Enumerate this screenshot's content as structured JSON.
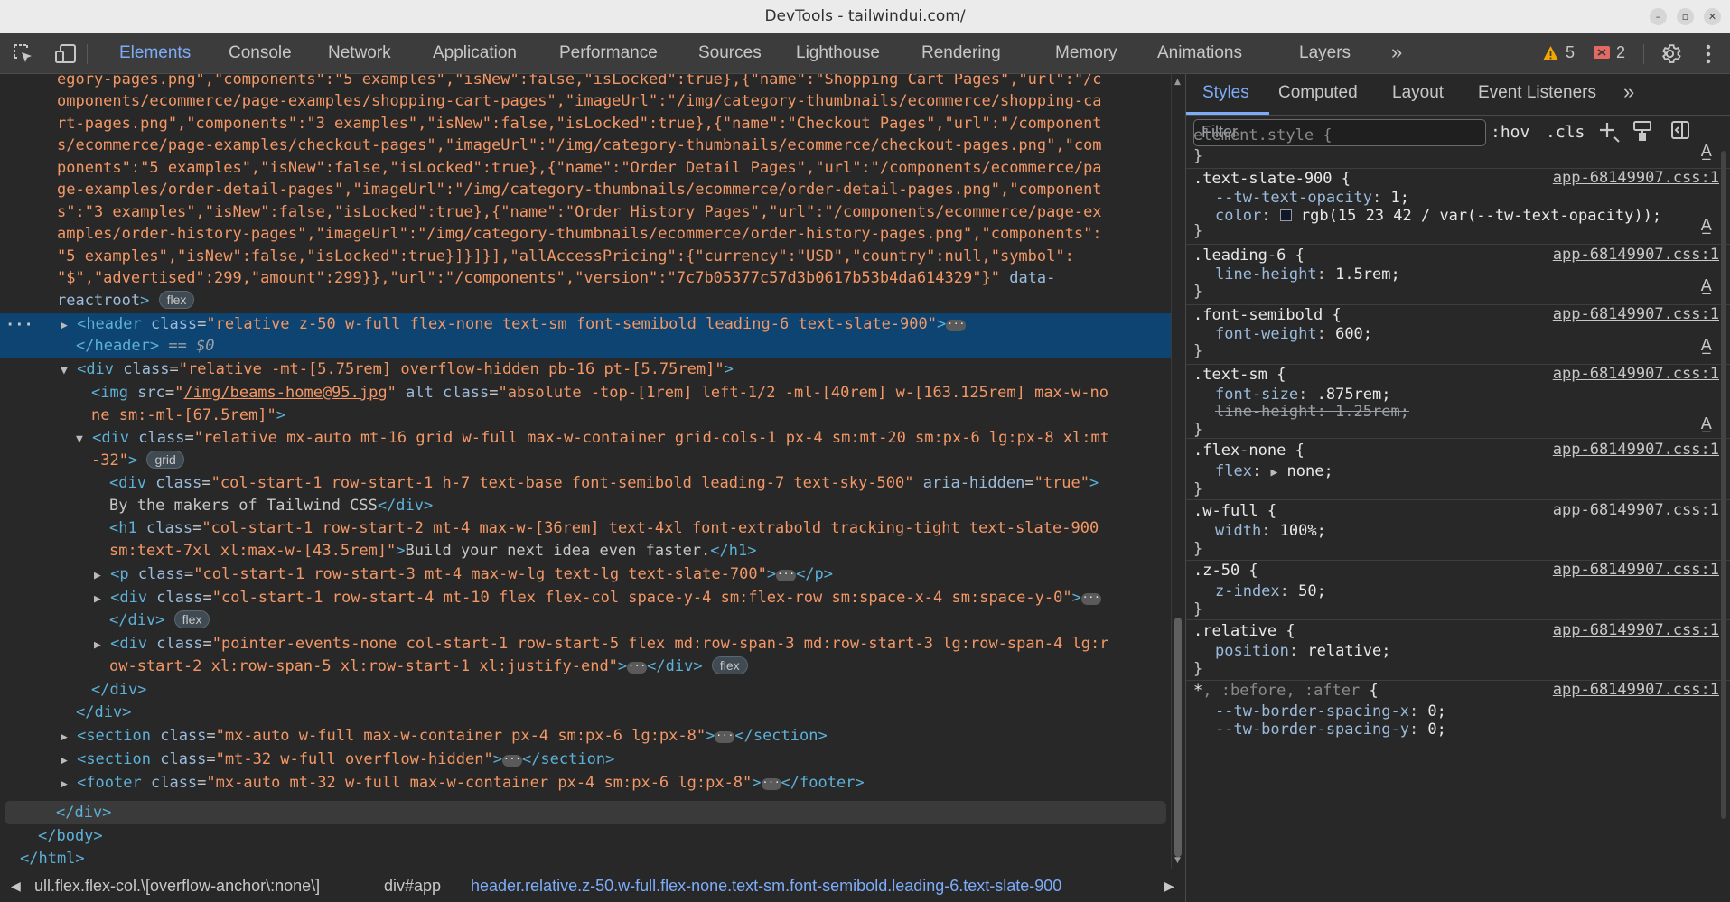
{
  "window": {
    "title": "DevTools - tailwindui.com/"
  },
  "toolbar": {
    "tabs": [
      "Elements",
      "Console",
      "Network",
      "Application",
      "Performance",
      "Sources",
      "Lighthouse",
      "Rendering",
      "Memory",
      "Animations",
      "Layers"
    ],
    "more": "»",
    "warnings": "5",
    "errors": "2"
  },
  "code": {
    "l1": "egory-pages.png\",\"components\":\"5 examples\",\"isNew\":false,\"isLocked\":true},{\"name\":\"Shopping Cart Pages\",\"url\":\"/c",
    "l2": "omponents/ecommerce/page-examples/shopping-cart-pages\",\"imageUrl\":\"/img/category-thumbnails/ecommerce/shopping-ca",
    "l3": "rt-pages.png\",\"components\":\"3 examples\",\"isNew\":false,\"isLocked\":true},{\"name\":\"Checkout Pages\",\"url\":\"/component",
    "l4": "s/ecommerce/page-examples/checkout-pages\",\"imageUrl\":\"/img/category-thumbnails/ecommerce/checkout-pages.png\",\"com",
    "l5": "ponents\":\"5 examples\",\"isNew\":false,\"isLocked\":true},{\"name\":\"Order Detail Pages\",\"url\":\"/components/ecommerce/pa",
    "l6": "ge-examples/order-detail-pages\",\"imageUrl\":\"/img/category-thumbnails/ecommerce/order-detail-pages.png\",\"component",
    "l7": "s\":\"3 examples\",\"isNew\":false,\"isLocked\":true},{\"name\":\"Order History Pages\",\"url\":\"/components/ecommerce/page-ex",
    "l8": "amples/order-history-pages\",\"imageUrl\":\"/img/category-thumbnails/ecommerce/order-history-pages.png\",\"components\":",
    "l9": "\"5 examples\",\"isNew\":false,\"isLocked\":true}]}]}],\"allAccessPricing\":{\"currency\":\"USD\",\"country\":null,\"symbol\":",
    "l10a": "\"$\",\"advertised\":299,\"amount\":299}},\"url\":\"/components\",\"version\":\"7c7b05377c57d3b0617b53b4da614329\"}\"",
    "l10b": " data-",
    "l11": "reactroot>",
    "pill_flex": "flex",
    "pill_grid": "grid",
    "header_class": "\"relative z-50 w-full flex-none text-sm font-semibold leading-6 text-slate-900\"",
    "header_close": "</header>",
    "eq": " == $0",
    "div1_class": "\"relative -mt-[5.75rem] overflow-hidden pb-16 pt-[5.75rem]\"",
    "img_src": "/img/beams-home@95.jpg",
    "img_class_a": "\"absolute -top-[1rem] left-1/2 -ml-[40rem] w-[163.125rem] max-w-no",
    "img_class_b": "ne sm:-ml-[67.5rem]\"",
    "div2_class_a": "\"relative mx-auto mt-16 grid w-full max-w-container grid-cols-1 px-4 sm:mt-20 sm:px-6 lg:px-8 xl:mt",
    "div2_class_b": "-32\"",
    "div3_class": "\"col-start-1 row-start-1 h-7 text-base font-semibold leading-7 text-sky-500\"",
    "div3_aria": "\"true\"",
    "div3_text": "By the makers of Tailwind CSS",
    "h1_class_a": "\"col-start-1 row-start-2 mt-4 max-w-[36rem] text-4xl font-extrabold tracking-tight text-slate-900",
    "h1_class_b": "sm:text-7xl xl:max-w-[43.5rem]\"",
    "h1_text": "Build your next idea even faster.",
    "p_class": "\"col-start-1 row-start-3 mt-4 max-w-lg text-lg text-slate-700\"",
    "div4_class": "\"col-start-1 row-start-4 mt-10 flex flex-col space-y-4 sm:flex-row sm:space-x-4 sm:space-y-0\"",
    "div5_class_a": "\"pointer-events-none col-start-1 row-start-5 flex md:row-span-3 md:row-start-3 lg:row-span-4 lg:r",
    "div5_class_b": "ow-start-2 xl:row-span-5 xl:row-start-1 xl:justify-end\"",
    "section1_class": "\"mx-auto w-full max-w-container px-4 sm:px-6 lg:px-8\"",
    "section2_class": "\"mt-32 w-full overflow-hidden\"",
    "footer_class": "\"mx-auto mt-32 w-full max-w-container px-4 sm:px-6 lg:px-8\""
  },
  "breadcrumbs": {
    "c1": "ull.flex.flex-col.\\[overflow-anchor\\:none\\]",
    "c2": "div#app",
    "c3": "header.relative.z-50.w-full.flex-none.text-sm.font-semibold.leading-6.text-slate-900"
  },
  "sidebar": {
    "tabs": [
      "Styles",
      "Computed",
      "Layout",
      "Event Listeners"
    ],
    "more": "»",
    "filter_placeholder": "Filter",
    "hov": ":hov",
    "cls": ".cls",
    "source": "app-68149907.css:1",
    "rules": {
      "element_style": "element.style {",
      "r1_sel": ".text-slate-900 {",
      "r1_p1": "--tw-text-opacity",
      "r1_v1": "1;",
      "r1_p2": "color",
      "r1_v2": "rgb(15 23 42 / var(--tw-text-opacity));",
      "r2_sel": ".leading-6 {",
      "r2_p1": "line-height",
      "r2_v1": "1.5rem;",
      "r3_sel": ".font-semibold {",
      "r3_p1": "font-weight",
      "r3_v1": "600;",
      "r4_sel": ".text-sm {",
      "r4_p1": "font-size",
      "r4_v1": ".875rem;",
      "r4_p2": "line-height: 1.25rem;",
      "r5_sel": ".flex-none {",
      "r5_p1": "flex",
      "r5_v1": "none;",
      "r6_sel": ".w-full {",
      "r6_p1": "width",
      "r6_v1": "100%;",
      "r7_sel": ".z-50 {",
      "r7_p1": "z-index",
      "r7_v1": "50;",
      "r8_sel": ".relative {",
      "r8_p1": "position",
      "r8_v1": "relative;",
      "r9_sel_a": "*",
      "r9_sel_b": ", :before, :after",
      "r9_sel_c": " {",
      "r9_p1": "--tw-border-spacing-x",
      "r9_v1": "0;",
      "r9_p2": "--tw-border-spacing-y",
      "r9_v2": "0;",
      "close": "}"
    }
  },
  "colors": {
    "accent": "#7cacf8",
    "selection": "#0e4471",
    "warning": "#f2a600",
    "error": "#e46962"
  }
}
